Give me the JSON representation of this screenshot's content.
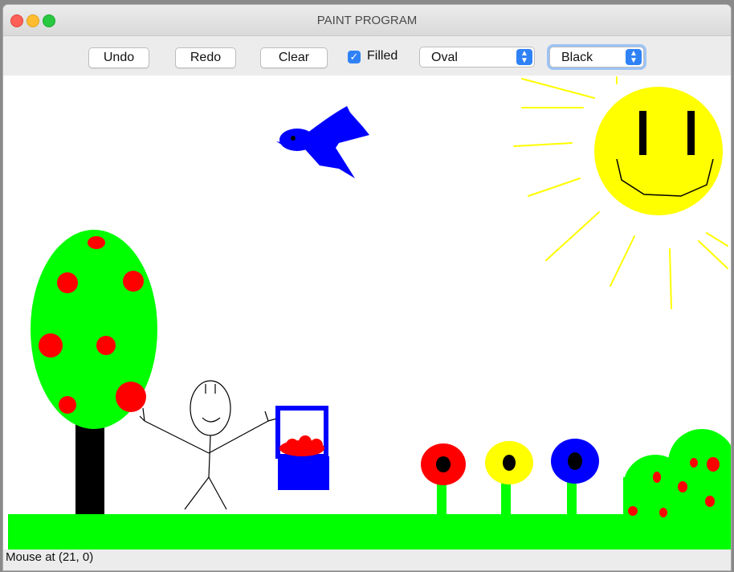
{
  "window": {
    "title": "PAINT PROGRAM"
  },
  "toolbar": {
    "undo_label": "Undo",
    "redo_label": "Redo",
    "clear_label": "Clear",
    "filled_label": "Filled",
    "filled_checked": true,
    "shape_select": "Oval",
    "color_select": "Black"
  },
  "status": {
    "text": "Mouse at (21, 0)"
  },
  "colors": {
    "accent": "#2f82f6",
    "green": "#00ff00",
    "red": "#ff0000",
    "blue": "#0000ff",
    "yellow": "#ffff00",
    "black": "#000000"
  }
}
